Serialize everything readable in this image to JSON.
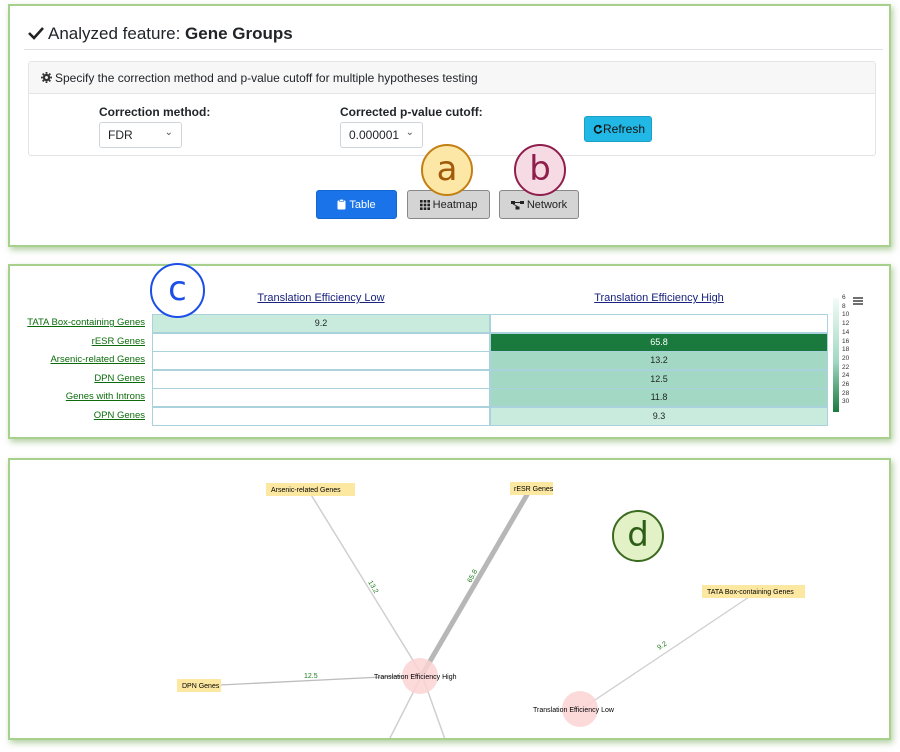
{
  "header": {
    "title_prefix": "Analyzed feature:",
    "title_value": "Gene Groups"
  },
  "correction_card": {
    "header_text": "Specify the correction method and p-value cutoff for multiple hypotheses testing",
    "method_label": "Correction method:",
    "method_value": "FDR",
    "cutoff_label": "Corrected p-value cutoff:",
    "cutoff_value": "0.000001",
    "refresh_label": "Refresh"
  },
  "view_buttons": {
    "table": "Table",
    "heatmap": "Heatmap",
    "network": "Network"
  },
  "annotation_badges": {
    "a": "a",
    "b": "b",
    "c": "c",
    "d": "d"
  },
  "heatmap": {
    "columns": [
      "Translation Efficiency Low",
      "Translation Efficiency High"
    ],
    "rows": [
      {
        "label": "TATA Box-containing Genes",
        "low": "9.2",
        "high": ""
      },
      {
        "label": "rESR Genes",
        "low": "",
        "high": "65.8"
      },
      {
        "label": "Arsenic-related Genes",
        "low": "",
        "high": "13.2"
      },
      {
        "label": "DPN Genes",
        "low": "",
        "high": "12.5"
      },
      {
        "label": "Genes with Introns",
        "low": "",
        "high": "11.8"
      },
      {
        "label": "OPN Genes",
        "low": "",
        "high": "9.3"
      }
    ],
    "legend_ticks": [
      "6",
      "8",
      "10",
      "12",
      "14",
      "16",
      "18",
      "20",
      "22",
      "24",
      "26",
      "28",
      "30"
    ],
    "colors": {
      "low": "#e8f6f0",
      "mid": "#a3d9c4",
      "high": "#1a7a3e"
    }
  },
  "network": {
    "nodes": {
      "te_high": "Translation Efficiency High",
      "te_low": "Translation Efficiency Low",
      "arsenic": "Arsenic-related Genes",
      "resr": "rESR Genes",
      "dpn": "DPN Genes",
      "tata": "TATA Box-containing Genes"
    },
    "edges": {
      "arsenic_high": "13.2",
      "resr_high": "65.8",
      "dpn_high": "12.5",
      "tata_low": "9.2"
    }
  }
}
